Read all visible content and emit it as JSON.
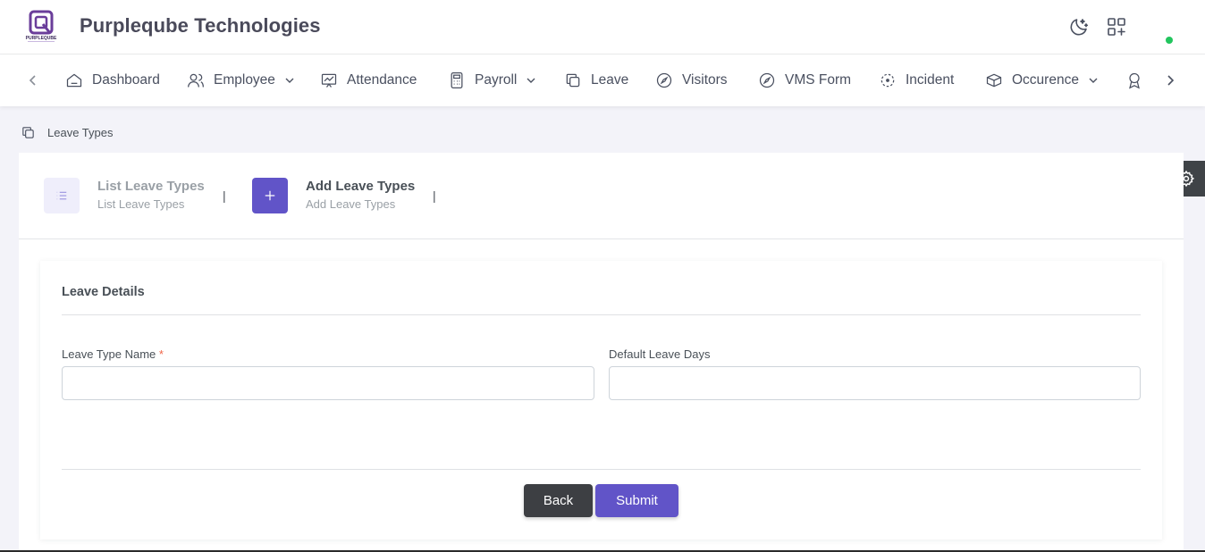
{
  "header": {
    "brand": "Purpleqube Technologies",
    "logo_text": "PURPLEQUBE"
  },
  "nav": {
    "items": [
      {
        "label": "Dashboard",
        "icon": "home-icon"
      },
      {
        "label": "Employee",
        "icon": "users-icon"
      },
      {
        "label": "Attendance",
        "icon": "presentation-icon"
      },
      {
        "label": "Payroll",
        "icon": "calculator-icon"
      },
      {
        "label": "Leave",
        "icon": "copy-icon"
      },
      {
        "label": "Visitors",
        "icon": "compass-icon"
      },
      {
        "label": "VMS Form",
        "icon": "compass-icon"
      },
      {
        "label": "Incident",
        "icon": "target-icon"
      },
      {
        "label": "Occurence",
        "icon": "boxes-icon"
      }
    ]
  },
  "breadcrumb": {
    "label": "Leave Types"
  },
  "steps": [
    {
      "title": "List Leave Types",
      "subtitle": "List Leave Types",
      "active": false
    },
    {
      "title": "Add Leave Types",
      "subtitle": "Add Leave Types",
      "active": true
    }
  ],
  "step_separator": "|",
  "form": {
    "title": "Leave Details",
    "fields": [
      {
        "label": "Leave Type Name",
        "required_mark": "*",
        "value": ""
      },
      {
        "label": "Default Leave Days",
        "value": ""
      }
    ],
    "back_label": "Back",
    "submit_label": "Submit"
  },
  "colors": {
    "primary": "#6154c8",
    "dark_button": "#3d3f43",
    "online": "#22c55e",
    "required": "#f06548"
  }
}
